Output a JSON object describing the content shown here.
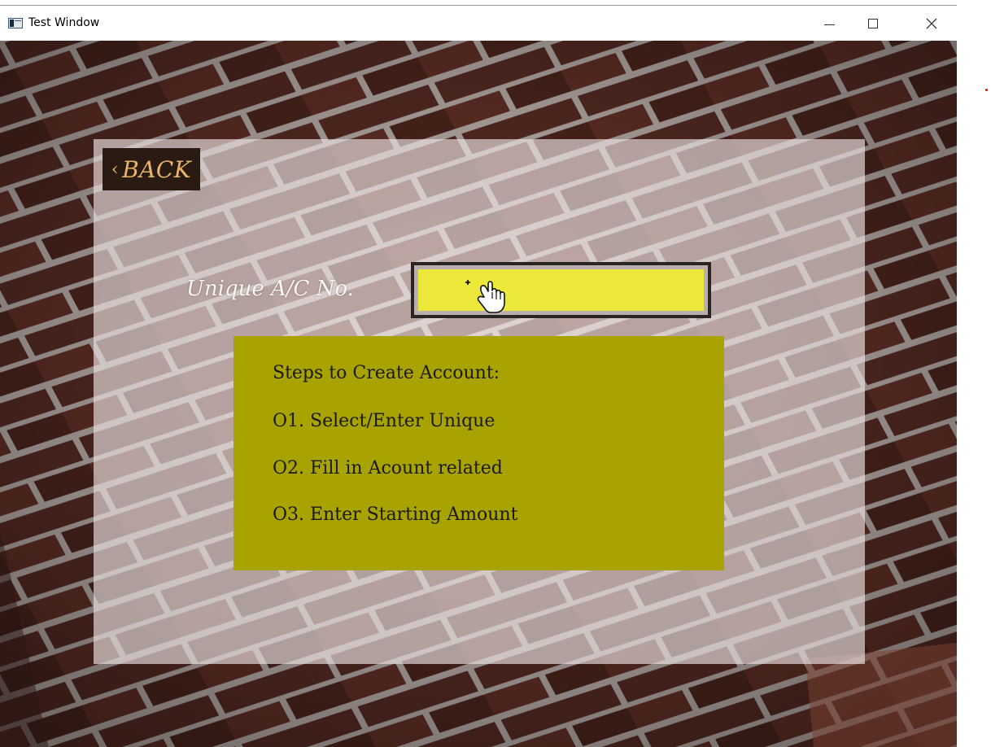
{
  "window": {
    "title": "Test Window",
    "controls": [
      "minimize",
      "maximize",
      "close"
    ],
    "close_glyph": "✕"
  },
  "colors": {
    "brick": "#5a2f25",
    "mortar": "#c9bdb8",
    "panel_overlay": "#ece2e2",
    "back_button_bg": "#2a1b12",
    "back_button_text": "#e8b46a",
    "input_fill": "#ece83a",
    "steps_bg": "#a8a300"
  },
  "back_button": {
    "chevron": "‹",
    "label": "BACK"
  },
  "account": {
    "label": "Unique A/C No.",
    "value": ""
  },
  "steps": {
    "title": "Steps to Create Account:",
    "items": [
      "O1. Select/Enter Unique",
      "O2. Fill in Acount related",
      "O3. Enter Starting Amount"
    ]
  },
  "icons": {
    "cursor": "hand-pointer-icon",
    "app": "app-window-icon"
  }
}
